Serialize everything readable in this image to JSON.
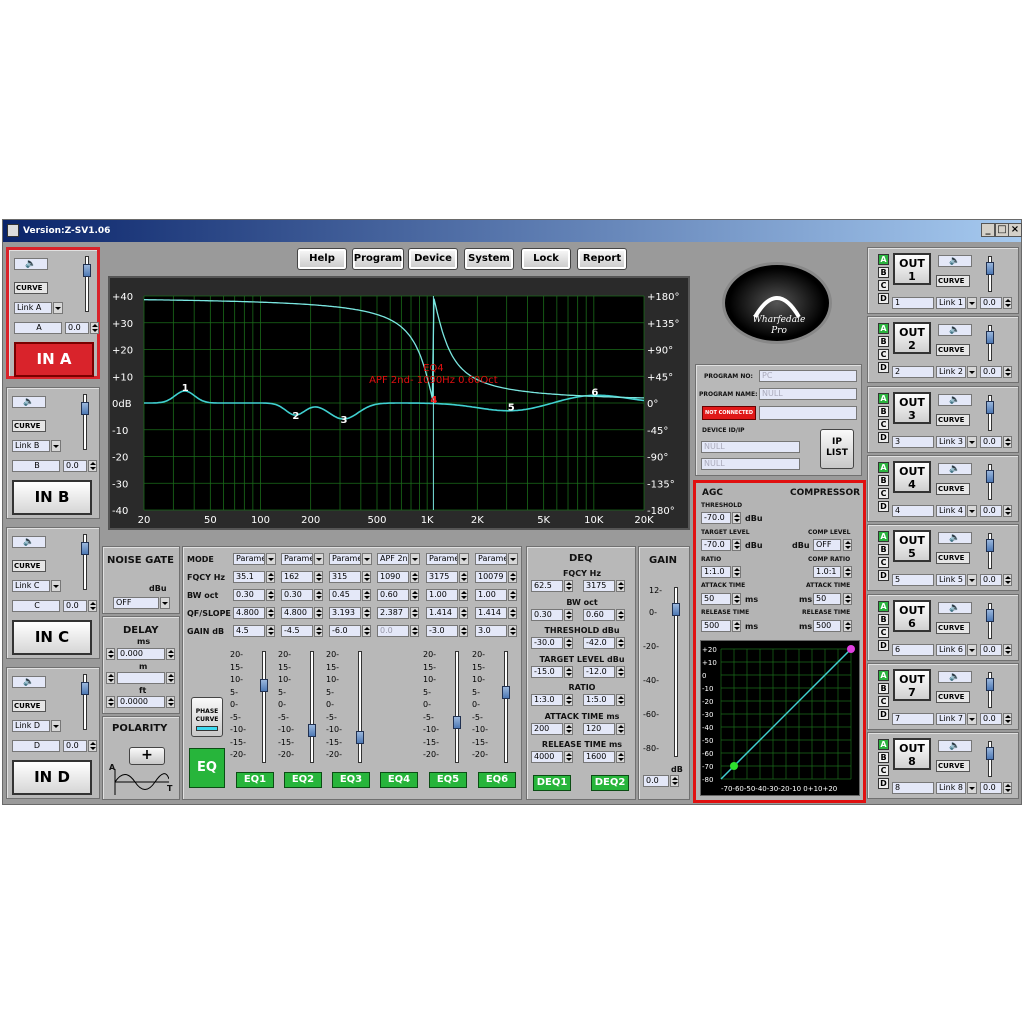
{
  "window": {
    "title": "Version:Z-SV1.06"
  },
  "menu": [
    "Help",
    "Program",
    "Device",
    "System",
    "Lock",
    "Report"
  ],
  "graph": {
    "left_ticks": [
      "+40",
      "+30",
      "+20",
      "+10",
      "0dB",
      "-10",
      "-20",
      "-30",
      "-40"
    ],
    "right_ticks": [
      "+180°",
      "+135°",
      "+90°",
      "+45°",
      "0°",
      "-45°",
      "-90°",
      "-135°",
      "-180°"
    ],
    "x_ticks": [
      "20",
      "50",
      "100",
      "200",
      "500",
      "1K",
      "2K",
      "5K",
      "10K",
      "20K"
    ],
    "tooltip_line1": "EQ4",
    "tooltip_line2": "APF 2nd- 1090Hz 0.60Oct",
    "points": [
      "1",
      "2",
      "3",
      "4",
      "5",
      "6"
    ]
  },
  "logo": {
    "text_line1": "Wharfedale",
    "text_line2": "Pro"
  },
  "program": {
    "no_label": "PROGRAM NO:",
    "no_value": "PC",
    "name_label": "PROGRAM NAME:",
    "name_value": "NULL",
    "status": "NOT CONNECTED",
    "device_label": "DEVICE ID/IP",
    "dev1": "NULL",
    "dev2": "NULL",
    "ip_btn_1": "IP",
    "ip_btn_2": "LIST"
  },
  "inputs": [
    {
      "curve": "CURVE",
      "link": "Link A",
      "name": "A",
      "gain": "0.0",
      "label": "IN A",
      "selected": true
    },
    {
      "curve": "CURVE",
      "link": "Link B",
      "name": "B",
      "gain": "0.0",
      "label": "IN B",
      "selected": false
    },
    {
      "curve": "CURVE",
      "link": "Link C",
      "name": "C",
      "gain": "0.0",
      "label": "IN C",
      "selected": false
    },
    {
      "curve": "CURVE",
      "link": "Link D",
      "name": "D",
      "gain": "0.0",
      "label": "IN D",
      "selected": false
    }
  ],
  "noise_gate": {
    "title": "NOISE GATE",
    "unit": "dBu",
    "value": "OFF"
  },
  "delay": {
    "title": "DELAY",
    "ms": "ms",
    "ms_val": "0.000",
    "m": "m",
    "m_val": "",
    "ft": "ft",
    "ft_val": "0.0000"
  },
  "polarity": {
    "title": "POLARITY",
    "sign": "+",
    "a": "A",
    "t": "T"
  },
  "eq": {
    "row_labels": [
      "MODE",
      "FQCY Hz",
      "BW oct",
      "QF/SLOPE",
      "GAIN dB"
    ],
    "bands": [
      {
        "mode": "Parame",
        "freq": "35.1",
        "bw": "0.30",
        "qf": "4.800",
        "gain": "4.5",
        "btn": "EQ1",
        "level": 0.45
      },
      {
        "mode": "Parame",
        "freq": "162",
        "bw": "0.30",
        "qf": "4.800",
        "gain": "-4.5",
        "btn": "EQ2",
        "level": -0.45
      },
      {
        "mode": "Parame",
        "freq": "315",
        "bw": "0.45",
        "qf": "3.193",
        "gain": "-6.0",
        "btn": "EQ3",
        "level": -0.6
      },
      {
        "mode": "APF 2n",
        "freq": "1090",
        "bw": "0.60",
        "qf": "2.387",
        "gain": "0.0",
        "btn": "EQ4",
        "level": null
      },
      {
        "mode": "Parame",
        "freq": "3175",
        "bw": "1.00",
        "qf": "1.414",
        "gain": "-3.0",
        "btn": "EQ5",
        "level": -0.3
      },
      {
        "mode": "Parame",
        "freq": "10079",
        "bw": "1.00",
        "qf": "1.414",
        "gain": "3.0",
        "btn": "EQ6",
        "level": 0.3
      }
    ],
    "scale": [
      "20-",
      "15-",
      "10-",
      "5-",
      "0-",
      "-5-",
      "-10-",
      "-15-",
      "-20-"
    ],
    "phase_curve_1": "PHASE",
    "phase_curve_2": "CURVE",
    "eq_btn": "EQ"
  },
  "deq": {
    "title": "DEQ",
    "fqcy": "FQCY Hz",
    "f1": "62.5",
    "f2": "3175",
    "bw": "BW oct",
    "b1": "0.30",
    "b2": "0.60",
    "thr": "THRESHOLD dBu",
    "t1": "-30.0",
    "t2": "-42.0",
    "tgt": "TARGET LEVEL dBu",
    "g1": "-15.0",
    "g2": "-12.0",
    "ratio": "RATIO",
    "r1": "1:3.0",
    "r2": "1:5.0",
    "att": "ATTACK TIME ms",
    "a1": "200",
    "a2": "120",
    "rel": "RELEASE TIME ms",
    "l1": "4000",
    "l2": "1600",
    "btn1": "DEQ1",
    "btn2": "DEQ2"
  },
  "gain": {
    "title": "GAIN",
    "scale": [
      "12-",
      "0-",
      "-20-",
      "-40-",
      "-60-",
      "-80-"
    ],
    "unit": "dB",
    "value": "0.0"
  },
  "agc": {
    "title": "AGC",
    "comp": "COMPRESSOR",
    "thr": "THRESHOLD",
    "thr_val": "-70.0",
    "dbu1": "dBu",
    "target": "TARGET LEVEL",
    "target_val": "-70.0",
    "dbu2": "dBu",
    "comp_level": "COMP LEVEL",
    "comp_level_unit": "dBu",
    "comp_level_val": "OFF",
    "ratio": "RATIO",
    "ratio_val": "1:1.0",
    "comp_ratio": "COMP RATIO",
    "comp_ratio_val": "1.0:1",
    "attack": "ATTACK TIME",
    "attack_val": "50",
    "ms1": "ms",
    "cattack": "ATTACK TIME",
    "cattack_val": "50",
    "ms2": "ms",
    "release": "RELEASE TIME",
    "release_val": "500",
    "ms3": "ms",
    "crelease": "RELEASE TIME",
    "crelease_val": "500",
    "ms4": "ms",
    "y_ticks": [
      "+20",
      "+10",
      "0",
      "-10",
      "-20",
      "-30",
      "-40",
      "-50",
      "-60",
      "-70",
      "-80"
    ],
    "x_ticks": "-70-60-50-40-30-20-10  0+10+20"
  },
  "outputs": [
    {
      "label_1": "OUT",
      "label_2": "1",
      "curve": "CURVE",
      "name": "1",
      "link": "Link 1",
      "gain": "0.0",
      "a_on": true
    },
    {
      "label_1": "OUT",
      "label_2": "2",
      "curve": "CURVE",
      "name": "2",
      "link": "Link 2",
      "gain": "0.0",
      "a_on": true
    },
    {
      "label_1": "OUT",
      "label_2": "3",
      "curve": "CURVE",
      "name": "3",
      "link": "Link 3",
      "gain": "0.0",
      "a_on": true
    },
    {
      "label_1": "OUT",
      "label_2": "4",
      "curve": "CURVE",
      "name": "4",
      "link": "Link 4",
      "gain": "0.0",
      "a_on": true
    },
    {
      "label_1": "OUT",
      "label_2": "5",
      "curve": "CURVE",
      "name": "5",
      "link": "Link 5",
      "gain": "0.0",
      "a_on": true
    },
    {
      "label_1": "OUT",
      "label_2": "6",
      "curve": "CURVE",
      "name": "6",
      "link": "Link 6",
      "gain": "0.0",
      "a_on": true
    },
    {
      "label_1": "OUT",
      "label_2": "7",
      "curve": "CURVE",
      "name": "7",
      "link": "Link 7",
      "gain": "0.0",
      "a_on": true
    },
    {
      "label_1": "OUT",
      "label_2": "8",
      "curve": "CURVE",
      "name": "8",
      "link": "Link 8",
      "gain": "0.0",
      "a_on": true
    }
  ],
  "abc_letters": [
    "A",
    "B",
    "C",
    "D"
  ],
  "colors": {
    "accent_red": "#d9232b",
    "green": "#27b53b",
    "graph_bg": "#000000",
    "grid": "#1a6b1a",
    "curve": "#40d0d0",
    "highlight": "#e01010"
  }
}
